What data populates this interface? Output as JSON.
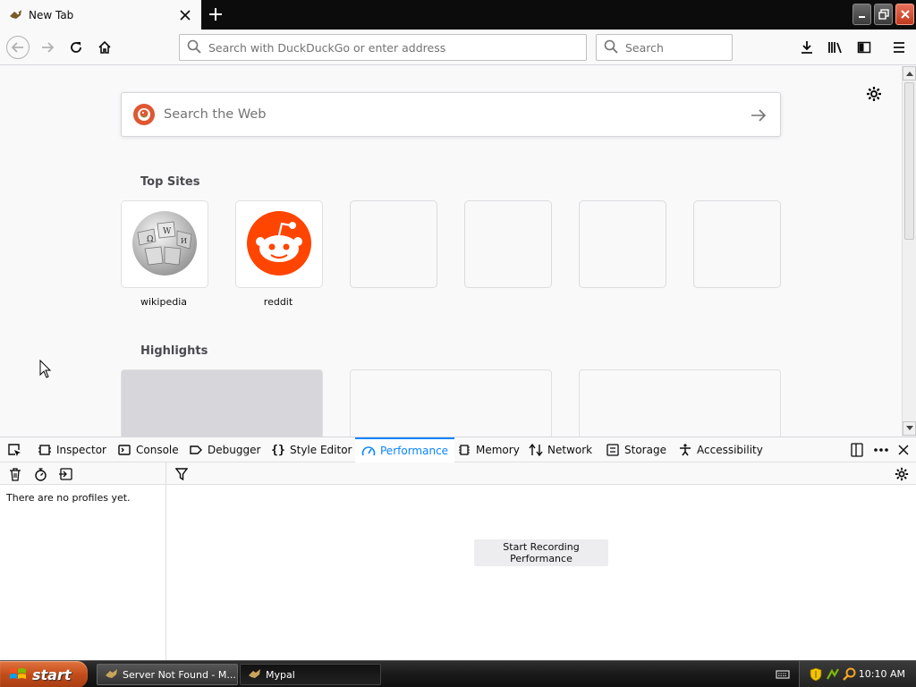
{
  "browser": {
    "tab_title": "New Tab",
    "url_placeholder": "Search with DuckDuckGo or enter address",
    "search_placeholder": "Search"
  },
  "newtab": {
    "web_search_placeholder": "Search the Web",
    "topsites_title": "Top Sites",
    "highlights_title": "Highlights",
    "topsites": [
      {
        "label": "wikipedia"
      },
      {
        "label": "reddit"
      }
    ]
  },
  "devtools": {
    "tabs": [
      {
        "label": "Inspector",
        "icon": "inspector-icon"
      },
      {
        "label": "Console",
        "icon": "console-icon"
      },
      {
        "label": "Debugger",
        "icon": "debugger-icon"
      },
      {
        "label": "Style Editor",
        "icon": "style-editor-icon"
      },
      {
        "label": "Performance",
        "icon": "performance-icon",
        "selected": true
      },
      {
        "label": "Memory",
        "icon": "memory-icon"
      },
      {
        "label": "Network",
        "icon": "network-icon"
      },
      {
        "label": "Storage",
        "icon": "storage-icon"
      },
      {
        "label": "Accessibility",
        "icon": "accessibility-icon"
      }
    ],
    "no_profiles": "There are no profiles yet.",
    "record_label": "Start Recording Performance",
    "accent": "#0a84ff"
  },
  "taskbar": {
    "start_label": "start",
    "tasks": [
      {
        "label": "Server Not Found - M..."
      },
      {
        "label": "Mypal"
      }
    ],
    "clock": "10:10 AM"
  }
}
